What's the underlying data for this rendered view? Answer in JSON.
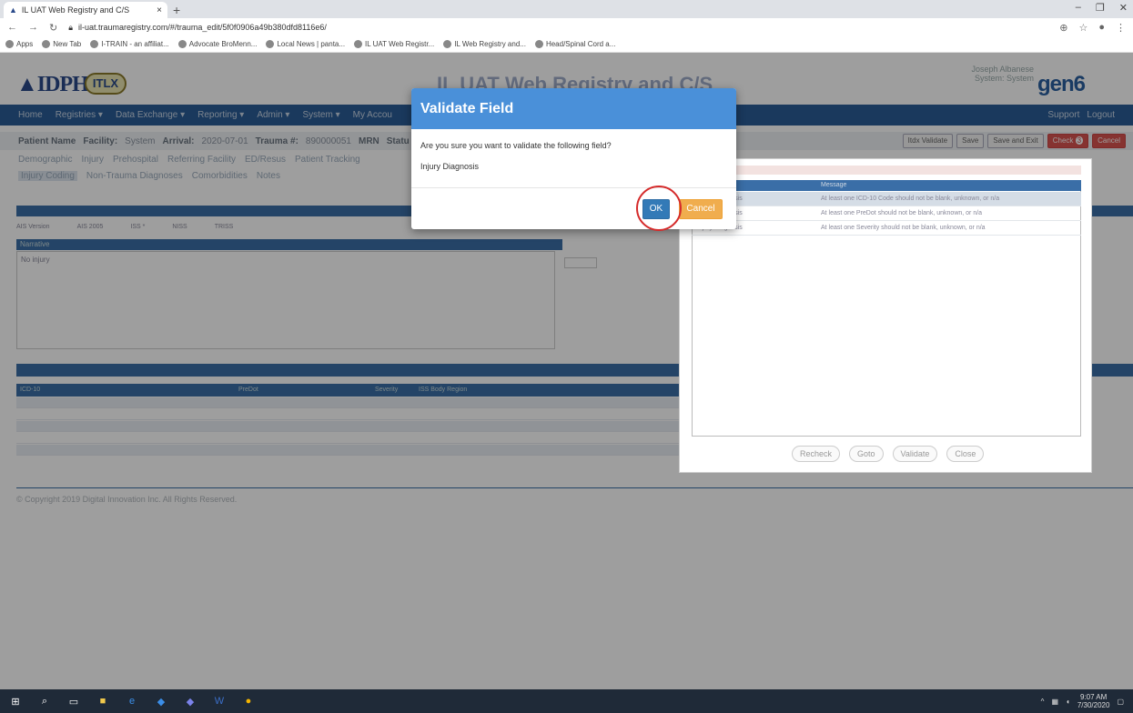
{
  "browser": {
    "tab_title": "IL UAT Web Registry and C/S",
    "url": "il-uat.traumaregistry.com/#/trauma_edit/5f0f0906a49b380dfd8116e6/",
    "bookmarks": [
      "Apps",
      "New Tab",
      "I-TRAIN - an affiliat...",
      "Advocate BroMenn...",
      "Local News | panta...",
      "IL UAT Web Registr...",
      "IL Web Registry and...",
      "Head/Spinal Cord a..."
    ]
  },
  "app": {
    "logo_idph": "IDPH",
    "logo_itlx": "ITLX",
    "title": "IL UAT Web Registry and C/S",
    "user_name": "Joseph Albanese",
    "user_role": "System: System",
    "brand": "gen6",
    "nav": [
      "Home",
      "Registries ▾",
      "Data Exchange ▾",
      "Reporting ▾",
      "Admin ▾",
      "System ▾",
      "My Accou"
    ],
    "nav_right": [
      "Support",
      "Logout"
    ],
    "patient_bar": {
      "patient_label": "Patient Name",
      "facility_label": "Facility:",
      "facility": "System",
      "arrival_label": "Arrival:",
      "arrival": "2020-07-01",
      "trauma_label": "Trauma #:",
      "trauma": "890000051",
      "mrn_label": "MRN",
      "status_label": "Statu"
    },
    "actions": {
      "itdx": "Itdx Validate",
      "save": "Save",
      "save_exit": "Save and Exit",
      "check": "Check",
      "check_count": "3",
      "cancel": "Cancel"
    },
    "subtabs_row1": [
      "Demographic",
      "Injury",
      "Prehospital",
      "Referring Facility",
      "ED/Resus",
      "Patient Tracking"
    ],
    "subtabs_row2": [
      "Injury Coding",
      "Non-Trauma Diagnoses",
      "Comorbidities",
      "Notes"
    ],
    "ais": [
      "AIS Version",
      "AIS 2005",
      "ISS *",
      "NISS",
      "TRISS"
    ],
    "narrative_label": "Narrative",
    "narrative_text": "No injury",
    "icd_columns": [
      "ICD-10",
      "PreDot",
      "Severity",
      "ISS Body Region"
    ],
    "copyright": "© Copyright 2019 Digital Innovation Inc. All Rights Reserved."
  },
  "check_panel": {
    "columns": [
      "",
      "Message"
    ],
    "rows": [
      {
        "field": "Injury Diagnosis",
        "message": "At least one ICD-10 Code should not be blank, unknown, or n/a"
      },
      {
        "field": "Injury Diagnosis",
        "message": "At least one PreDot should not be blank, unknown, or n/a"
      },
      {
        "field": "Injury Diagnosis",
        "message": "At least one Severity should not be blank, unknown, or n/a"
      }
    ],
    "buttons": [
      "Recheck",
      "Goto",
      "Validate",
      "Close"
    ]
  },
  "modal": {
    "title": "Validate Field",
    "question": "Are you sure you want to validate the following field?",
    "field": "Injury Diagnosis",
    "ok": "OK",
    "cancel": "Cancel"
  },
  "taskbar": {
    "time": "9:07 AM",
    "date": "7/30/2020"
  }
}
